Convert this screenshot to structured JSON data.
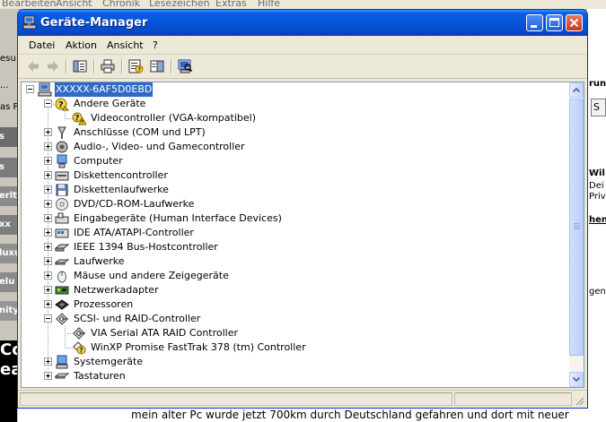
{
  "background": {
    "browser_menu": [
      "Bearbeiten",
      "Ansicht",
      "Chronik",
      "Lesezeichen",
      "Extras",
      "Hilfe"
    ],
    "left_fragments": [
      "esu",
      "...",
      "as P",
      "s",
      "s",
      "erlt",
      "xx",
      "luxu",
      "elu",
      "nity",
      "Co",
      "ea"
    ],
    "right_fragments": [
      "run",
      "S",
      "Wil",
      "Dei",
      "Priv",
      "hen",
      "gen"
    ],
    "bottom_text": "mein alter Pc wurde jetzt 700km durch Deutschland gefahren und dort mit neuer"
  },
  "window": {
    "title": "Geräte-Manager",
    "menu": [
      "Datei",
      "Aktion",
      "Ansicht",
      "?"
    ],
    "toolbar_icons": [
      "back-arrow-icon",
      "forward-arrow-icon",
      "console-tree-icon",
      "print-icon",
      "properties-icon",
      "help-pane-icon",
      "scan-hardware-icon"
    ],
    "colors": {
      "title_bar": "#0553d9",
      "selection": "#316ac5",
      "close_button": "#c5381b"
    }
  },
  "tree": {
    "root": "XXXXX-6AF5D0EBD",
    "nodes": [
      {
        "label": "Andere Geräte",
        "icon": "unknown-device-icon",
        "expanded": true,
        "children": [
          {
            "label": "Videocontroller (VGA-kompatibel)",
            "icon": "warning-device-icon"
          }
        ]
      },
      {
        "label": "Anschlüsse (COM und LPT)",
        "icon": "port-icon",
        "expanded": false
      },
      {
        "label": "Audio-, Video- und Gamecontroller",
        "icon": "speaker-icon",
        "expanded": false
      },
      {
        "label": "Computer",
        "icon": "computer-icon",
        "expanded": false
      },
      {
        "label": "Diskettencontroller",
        "icon": "controller-icon",
        "expanded": false
      },
      {
        "label": "Diskettenlaufwerke",
        "icon": "floppy-drive-icon",
        "expanded": false
      },
      {
        "label": "DVD/CD-ROM-Laufwerke",
        "icon": "cd-drive-icon",
        "expanded": false
      },
      {
        "label": "Eingabegeräte (Human Interface Devices)",
        "icon": "hid-icon",
        "expanded": false
      },
      {
        "label": "IDE ATA/ATAPI-Controller",
        "icon": "ide-icon",
        "expanded": false
      },
      {
        "label": "IEEE 1394 Bus-Hostcontroller",
        "icon": "firewire-icon",
        "expanded": false
      },
      {
        "label": "Laufwerke",
        "icon": "disk-drive-icon",
        "expanded": false
      },
      {
        "label": "Mäuse und andere Zeigegeräte",
        "icon": "mouse-icon",
        "expanded": false
      },
      {
        "label": "Netzwerkadapter",
        "icon": "network-card-icon",
        "expanded": false
      },
      {
        "label": "Prozessoren",
        "icon": "processor-icon",
        "expanded": false
      },
      {
        "label": "SCSI- und RAID-Controller",
        "icon": "scsi-icon",
        "expanded": true,
        "children": [
          {
            "label": "VIA Serial ATA RAID Controller",
            "icon": "scsi-icon"
          },
          {
            "label": "WinXP Promise FastTrak 378 (tm) Controller",
            "icon": "warning-device-icon"
          }
        ]
      },
      {
        "label": "Systemgeräte",
        "icon": "system-device-icon",
        "expanded": false
      },
      {
        "label": "Tastaturen",
        "icon": "keyboard-icon",
        "expanded": false
      }
    ]
  }
}
